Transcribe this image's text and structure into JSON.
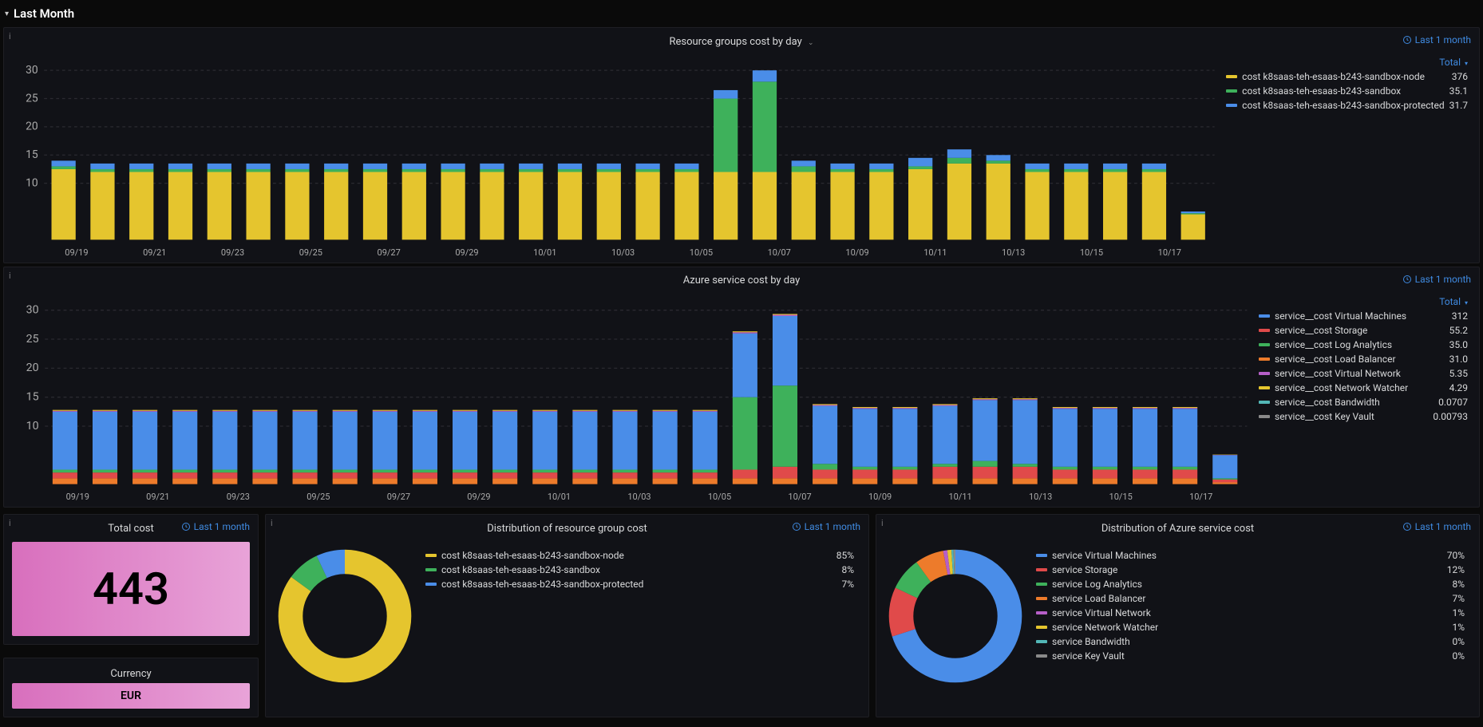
{
  "colors": {
    "yellow": "#e5c52e",
    "green": "#3eb15b",
    "blue": "#4a8de8",
    "red": "#e04a4a",
    "orange": "#ed7b2b",
    "teal": "#53b7b7",
    "purple": "#b65fc8",
    "grey": "#8a8a8a"
  },
  "section": {
    "title": "Last Month"
  },
  "time_label": "Last 1 month",
  "panel1": {
    "title": "Resource groups cost by day",
    "legend_header": "Total",
    "legend": [
      {
        "color_key": "yellow",
        "label": "cost k8saas-teh-esaas-b243-sandbox-node",
        "value": "376"
      },
      {
        "color_key": "green",
        "label": "cost k8saas-teh-esaas-b243-sandbox",
        "value": "35.1"
      },
      {
        "color_key": "blue",
        "label": "cost k8saas-teh-esaas-b243-sandbox-protected",
        "value": "31.7"
      }
    ]
  },
  "panel2": {
    "title": "Azure service cost by day",
    "legend_header": "Total",
    "legend": [
      {
        "color_key": "blue",
        "label": "service__cost Virtual Machines",
        "value": "312"
      },
      {
        "color_key": "red",
        "label": "service__cost Storage",
        "value": "55.2"
      },
      {
        "color_key": "green",
        "label": "service__cost Log Analytics",
        "value": "35.0"
      },
      {
        "color_key": "orange",
        "label": "service__cost Load Balancer",
        "value": "31.0"
      },
      {
        "color_key": "purple",
        "label": "service__cost Virtual Network",
        "value": "5.35"
      },
      {
        "color_key": "yellow",
        "label": "service__cost Network Watcher",
        "value": "4.29"
      },
      {
        "color_key": "teal",
        "label": "service__cost Bandwidth",
        "value": "0.0707"
      },
      {
        "color_key": "grey",
        "label": "service__cost Key Vault",
        "value": "0.00793"
      }
    ]
  },
  "panel_total": {
    "title": "Total cost",
    "value": "443",
    "currency_label": "Currency",
    "currency_value": "EUR"
  },
  "panel_donut_rg": {
    "title": "Distribution of resource group cost",
    "legend": [
      {
        "color_key": "yellow",
        "label": "cost k8saas-teh-esaas-b243-sandbox-node",
        "value": "85%"
      },
      {
        "color_key": "green",
        "label": "cost k8saas-teh-esaas-b243-sandbox",
        "value": "8%"
      },
      {
        "color_key": "blue",
        "label": "cost k8saas-teh-esaas-b243-sandbox-protected",
        "value": "7%"
      }
    ]
  },
  "panel_donut_svc": {
    "title": "Distribution of Azure service cost",
    "legend": [
      {
        "color_key": "blue",
        "label": "service Virtual Machines",
        "value": "70%"
      },
      {
        "color_key": "red",
        "label": "service Storage",
        "value": "12%"
      },
      {
        "color_key": "green",
        "label": "service Log Analytics",
        "value": "8%"
      },
      {
        "color_key": "orange",
        "label": "service Load Balancer",
        "value": "7%"
      },
      {
        "color_key": "purple",
        "label": "service Virtual Network",
        "value": "1%"
      },
      {
        "color_key": "yellow",
        "label": "service Network Watcher",
        "value": "1%"
      },
      {
        "color_key": "teal",
        "label": "service Bandwidth",
        "value": "0%"
      },
      {
        "color_key": "grey",
        "label": "service Key Vault",
        "value": "0%"
      }
    ]
  },
  "chart_data": [
    {
      "id": "resource_groups_cost_by_day",
      "type": "bar",
      "stacked": true,
      "ylim": [
        0,
        32
      ],
      "yticks": [
        10,
        15,
        20,
        25,
        30
      ],
      "x_tick_labels": [
        "09/19",
        "09/21",
        "09/23",
        "09/25",
        "09/27",
        "09/29",
        "10/01",
        "10/03",
        "10/05",
        "10/07",
        "10/09",
        "10/11",
        "10/13",
        "10/15",
        "10/17"
      ],
      "categories": [
        "09/19",
        "09/20",
        "09/21",
        "09/22",
        "09/23",
        "09/24",
        "09/25",
        "09/26",
        "09/27",
        "09/28",
        "09/29",
        "09/30",
        "10/01",
        "10/02",
        "10/03",
        "10/04",
        "10/05",
        "10/06",
        "10/07",
        "10/08",
        "10/09",
        "10/10",
        "10/11",
        "10/12",
        "10/13",
        "10/14",
        "10/15",
        "10/16",
        "10/17",
        "10/18"
      ],
      "series": [
        {
          "name": "cost k8saas-teh-esaas-b243-sandbox-node",
          "color_key": "yellow",
          "values": [
            12.5,
            12,
            12,
            12,
            12,
            12,
            12,
            12,
            12,
            12,
            12,
            12,
            12,
            12,
            12,
            12,
            12,
            12,
            12,
            12,
            12,
            12,
            12.5,
            13.5,
            13.5,
            12,
            12,
            12,
            12,
            4.5
          ]
        },
        {
          "name": "cost k8saas-teh-esaas-b243-sandbox",
          "color_key": "green",
          "values": [
            0.5,
            0.5,
            0.5,
            0.5,
            0.5,
            0.5,
            0.5,
            0.5,
            0.5,
            0.5,
            0.5,
            0.5,
            0.5,
            0.5,
            0.5,
            0.5,
            0.5,
            13,
            16,
            1,
            0.5,
            0.5,
            0.5,
            1,
            0.5,
            0.5,
            0.5,
            0.5,
            0.5,
            0.2
          ]
        },
        {
          "name": "cost k8saas-teh-esaas-b243-sandbox-protected",
          "color_key": "blue",
          "values": [
            1,
            1,
            1,
            1,
            1,
            1,
            1,
            1,
            1,
            1,
            1,
            1,
            1,
            1,
            1,
            1,
            1,
            1.5,
            2,
            1,
            1,
            1,
            1.5,
            1.5,
            1,
            1,
            1,
            1,
            1,
            0.3
          ]
        }
      ]
    },
    {
      "id": "azure_service_cost_by_day",
      "type": "bar",
      "stacked": true,
      "ylim": [
        0,
        32
      ],
      "yticks": [
        10,
        15,
        20,
        25,
        30
      ],
      "x_tick_labels": [
        "09/19",
        "09/21",
        "09/23",
        "09/25",
        "09/27",
        "09/29",
        "10/01",
        "10/03",
        "10/05",
        "10/07",
        "10/09",
        "10/11",
        "10/13",
        "10/15",
        "10/17"
      ],
      "categories": [
        "09/19",
        "09/20",
        "09/21",
        "09/22",
        "09/23",
        "09/24",
        "09/25",
        "09/26",
        "09/27",
        "09/28",
        "09/29",
        "09/30",
        "10/01",
        "10/02",
        "10/03",
        "10/04",
        "10/05",
        "10/06",
        "10/07",
        "10/08",
        "10/09",
        "10/10",
        "10/11",
        "10/12",
        "10/13",
        "10/14",
        "10/15",
        "10/16",
        "10/17",
        "10/18"
      ],
      "series": [
        {
          "name": "service__cost Load Balancer",
          "color_key": "orange",
          "values": [
            1,
            1,
            1,
            1,
            1,
            1,
            1,
            1,
            1,
            1,
            1,
            1,
            1,
            1,
            1,
            1,
            1,
            1,
            1,
            1,
            1,
            1,
            1,
            1,
            1,
            1,
            1,
            1,
            1,
            0.3
          ]
        },
        {
          "name": "service__cost Storage",
          "color_key": "red",
          "values": [
            1,
            1,
            1,
            1,
            1,
            1,
            1,
            1,
            1,
            1,
            1,
            1,
            1,
            1,
            1,
            1,
            1,
            1.5,
            2,
            1.5,
            1.5,
            1.5,
            2,
            2,
            2,
            1.5,
            1.5,
            1.5,
            1.5,
            0.5
          ]
        },
        {
          "name": "service__cost Log Analytics",
          "color_key": "green",
          "values": [
            0.5,
            0.5,
            0.5,
            0.5,
            0.5,
            0.5,
            0.5,
            0.5,
            0.5,
            0.5,
            0.5,
            0.5,
            0.5,
            0.5,
            0.5,
            0.5,
            0.5,
            12.5,
            14,
            1,
            0.5,
            0.5,
            0.5,
            1,
            0.5,
            0.5,
            0.5,
            0.5,
            0.5,
            0.2
          ]
        },
        {
          "name": "service__cost Virtual Machines",
          "color_key": "blue",
          "values": [
            10,
            10,
            10,
            10,
            10,
            10,
            10,
            10,
            10,
            10,
            10,
            10,
            10,
            10,
            10,
            10,
            10,
            11,
            12,
            10,
            10,
            10,
            10,
            10.5,
            11,
            10,
            10,
            10,
            10,
            4
          ]
        },
        {
          "name": "service__cost Virtual Network",
          "color_key": "purple",
          "values": [
            0.15,
            0.15,
            0.15,
            0.15,
            0.15,
            0.15,
            0.15,
            0.15,
            0.15,
            0.15,
            0.15,
            0.15,
            0.15,
            0.15,
            0.15,
            0.15,
            0.15,
            0.2,
            0.2,
            0.15,
            0.15,
            0.15,
            0.15,
            0.15,
            0.15,
            0.15,
            0.15,
            0.15,
            0.15,
            0.05
          ]
        },
        {
          "name": "service__cost Network Watcher",
          "color_key": "yellow",
          "values": [
            0.15,
            0.15,
            0.15,
            0.15,
            0.15,
            0.15,
            0.15,
            0.15,
            0.15,
            0.15,
            0.15,
            0.15,
            0.15,
            0.15,
            0.15,
            0.15,
            0.15,
            0.15,
            0.15,
            0.15,
            0.15,
            0.15,
            0.15,
            0.15,
            0.15,
            0.15,
            0.15,
            0.15,
            0.15,
            0.05
          ]
        },
        {
          "name": "service__cost Bandwidth",
          "color_key": "teal",
          "values": [
            0,
            0,
            0,
            0,
            0,
            0,
            0,
            0,
            0,
            0,
            0,
            0,
            0,
            0,
            0,
            0,
            0,
            0,
            0,
            0,
            0,
            0,
            0,
            0,
            0,
            0,
            0,
            0,
            0,
            0
          ]
        },
        {
          "name": "service__cost Key Vault",
          "color_key": "grey",
          "values": [
            0,
            0,
            0,
            0,
            0,
            0,
            0,
            0,
            0,
            0,
            0,
            0,
            0,
            0,
            0,
            0,
            0,
            0,
            0,
            0,
            0,
            0,
            0,
            0,
            0,
            0,
            0,
            0,
            0,
            0
          ]
        }
      ]
    },
    {
      "id": "distribution_resource_group",
      "type": "pie",
      "slices": [
        {
          "label": "cost k8saas-teh-esaas-b243-sandbox-node",
          "value": 85,
          "color_key": "yellow"
        },
        {
          "label": "cost k8saas-teh-esaas-b243-sandbox",
          "value": 8,
          "color_key": "green"
        },
        {
          "label": "cost k8saas-teh-esaas-b243-sandbox-protected",
          "value": 7,
          "color_key": "blue"
        }
      ]
    },
    {
      "id": "distribution_azure_service",
      "type": "pie",
      "slices": [
        {
          "label": "service Virtual Machines",
          "value": 70,
          "color_key": "blue"
        },
        {
          "label": "service Storage",
          "value": 12,
          "color_key": "red"
        },
        {
          "label": "service Log Analytics",
          "value": 8,
          "color_key": "green"
        },
        {
          "label": "service Load Balancer",
          "value": 7,
          "color_key": "orange"
        },
        {
          "label": "service Virtual Network",
          "value": 1,
          "color_key": "purple"
        },
        {
          "label": "service Network Watcher",
          "value": 1,
          "color_key": "yellow"
        },
        {
          "label": "service Bandwidth",
          "value": 0.5,
          "color_key": "teal"
        },
        {
          "label": "service Key Vault",
          "value": 0.5,
          "color_key": "grey"
        }
      ]
    }
  ]
}
